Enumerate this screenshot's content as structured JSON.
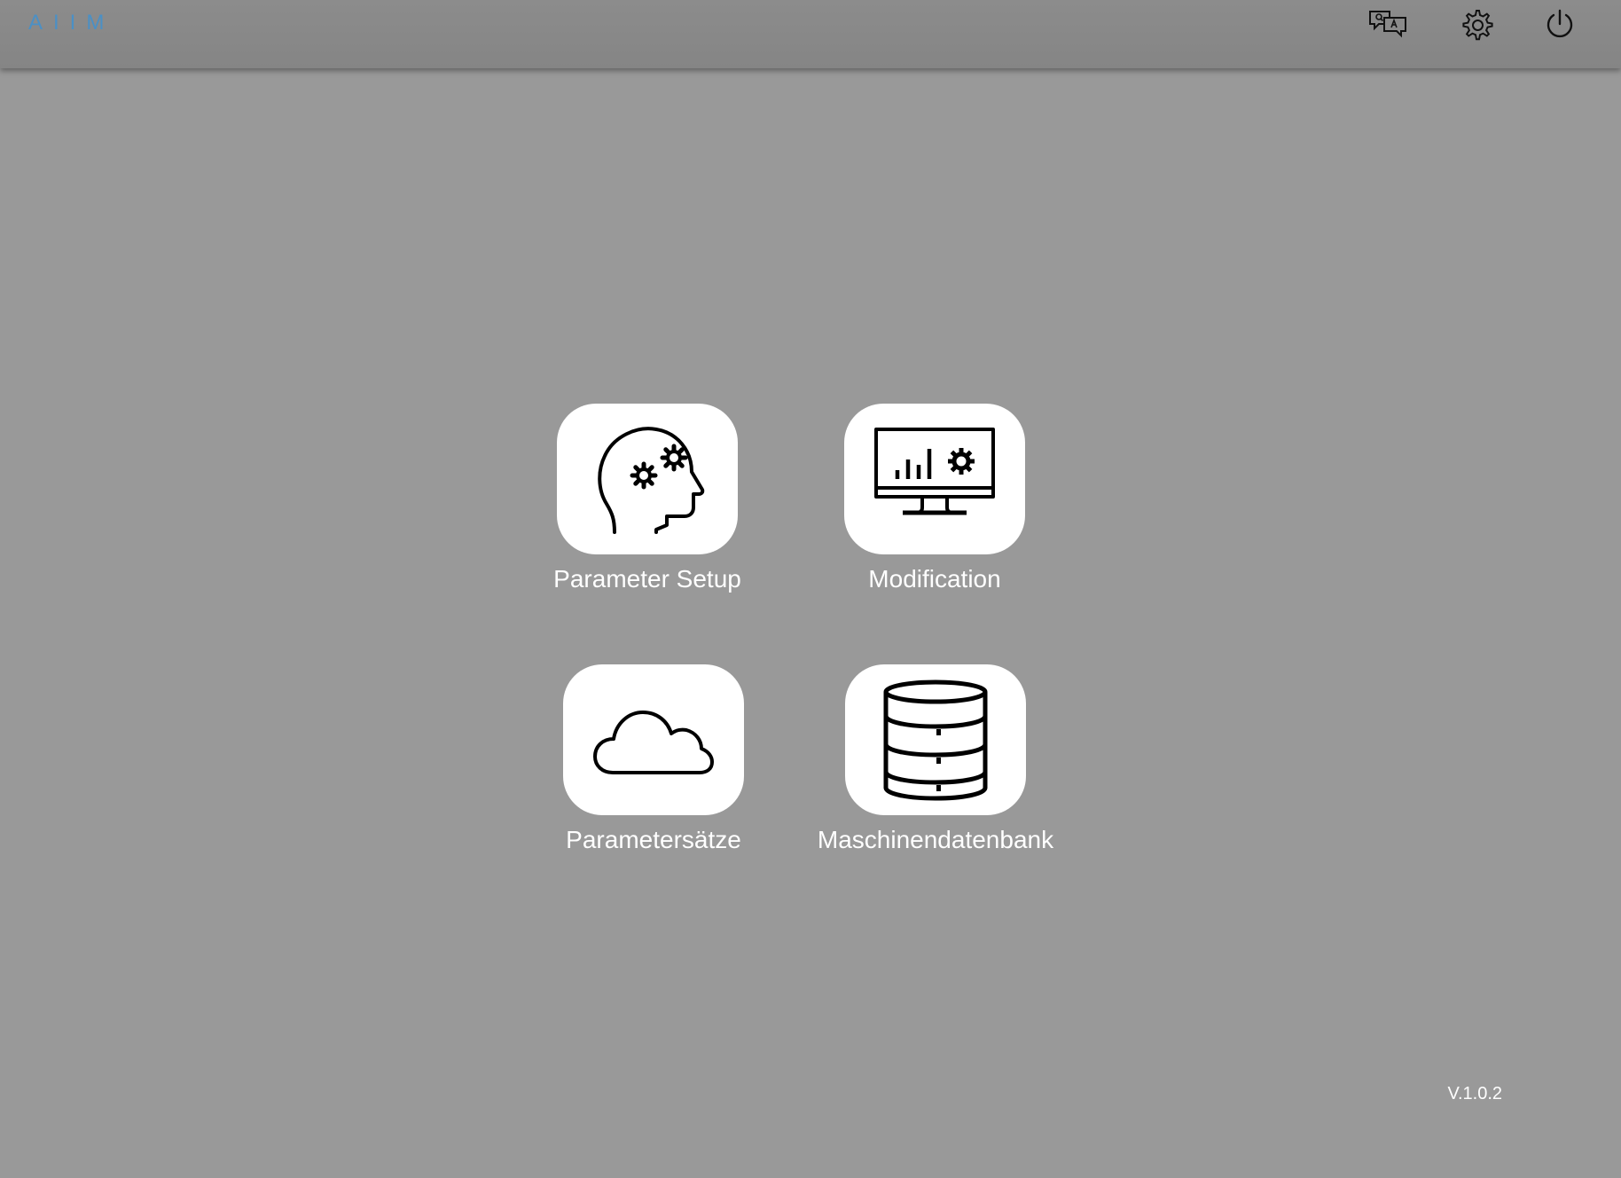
{
  "header": {
    "logo_text": "AIIM",
    "icons": [
      "translate-icon",
      "gear-icon",
      "power-icon"
    ]
  },
  "tiles": [
    {
      "label": "Parameter Setup",
      "icon": "head-gears-icon"
    },
    {
      "label": "Modification",
      "icon": "monitor-chart-icon"
    },
    {
      "label": "Parametersätze",
      "icon": "cloud-icon"
    },
    {
      "label": "Maschinendatenbank",
      "icon": "database-icon"
    }
  ],
  "footer": {
    "version": "V.1.0.2"
  },
  "colors": {
    "background": "#999999",
    "topbar": "#888888",
    "tile": "#ffffff",
    "logo": "#4a90c6"
  }
}
